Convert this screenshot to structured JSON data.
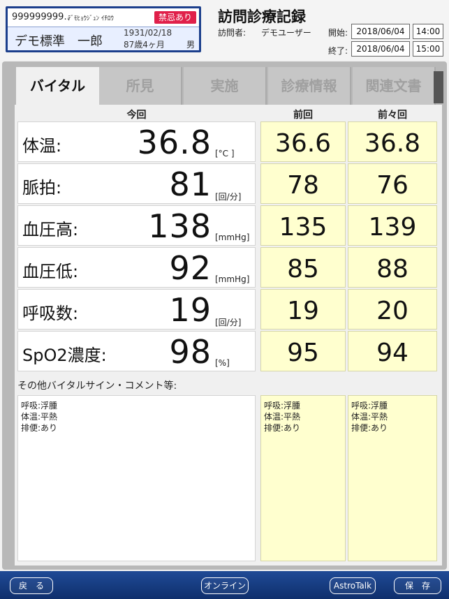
{
  "patient": {
    "id": "999999999..",
    "kana": "ﾃﾞﾓﾋｮｳｼﾞｭﾝ ｲﾁﾛｳ",
    "alert_badge": "禁忌あり",
    "name": "デモ標準　一郎",
    "dob": "1931/02/18",
    "age": "87歳4ヶ月",
    "sex": "男"
  },
  "record": {
    "title": "訪問診療記録",
    "visitor_label": "訪問者:",
    "visitor_name": "デモユーザー",
    "start_label": "開始:",
    "start_date": "2018/06/04",
    "start_time": "14:00",
    "end_label": "終了:",
    "end_date": "2018/06/04",
    "end_time": "15:00"
  },
  "tabs": [
    {
      "label": "バイタル",
      "active": true
    },
    {
      "label": "所見",
      "active": false
    },
    {
      "label": "実施",
      "active": false
    },
    {
      "label": "診療情報",
      "active": false
    },
    {
      "label": "関連文書",
      "active": false
    }
  ],
  "columns": {
    "current": "今回",
    "previous": "前回",
    "before_previous": "前々回"
  },
  "vitals": [
    {
      "label": "体温:",
      "current": "36.8",
      "unit": "[°C ]",
      "previous": "36.6",
      "before_previous": "36.8"
    },
    {
      "label": "脈拍:",
      "current": "81",
      "unit": "[回/分]",
      "previous": "78",
      "before_previous": "76"
    },
    {
      "label": "血圧高:",
      "current": "138",
      "unit": "[mmHg]",
      "previous": "135",
      "before_previous": "139"
    },
    {
      "label": "血圧低:",
      "current": "92",
      "unit": "[mmHg]",
      "previous": "85",
      "before_previous": "88"
    },
    {
      "label": "呼吸数:",
      "current": "19",
      "unit": "[回/分]",
      "previous": "19",
      "before_previous": "20"
    },
    {
      "label": "SpO2濃度:",
      "current": "98",
      "unit": "[%]",
      "previous": "95",
      "before_previous": "94"
    }
  ],
  "comments": {
    "heading": "その他バイタルサイン・コメント等:",
    "current": "呼吸:浮腫\n体温:平熱\n排便:あり",
    "previous": "呼吸:浮腫\n体温:平熱\n排便:あり",
    "before_previous": "呼吸:浮腫\n体温:平熱\n排便:あり"
  },
  "footer": {
    "back": "戻　る",
    "online": "オンライン",
    "astrotalk": "AstroTalk",
    "save": "保　存"
  },
  "colors": {
    "header_blue": "#1c3f8c",
    "alert_red": "#e0204a",
    "history_yellow": "#ffffcf",
    "footer_blue": "#1f4a96"
  }
}
